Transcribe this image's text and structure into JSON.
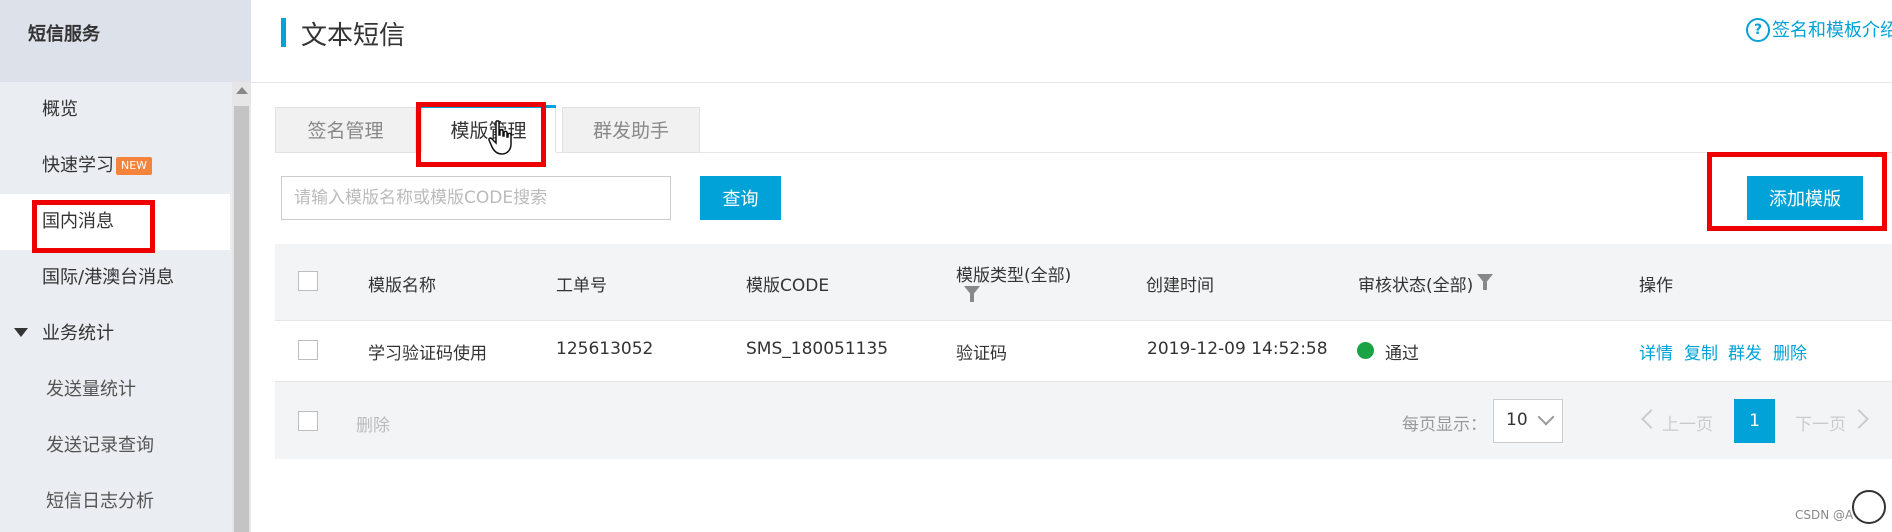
{
  "sidebar": {
    "title": "短信服务",
    "items": [
      {
        "label": "概览"
      },
      {
        "label": "快速学习",
        "badge": "NEW"
      },
      {
        "label": "国内消息"
      },
      {
        "label": "国际/港澳台消息"
      },
      {
        "label": "业务统计"
      },
      {
        "label": "发送量统计"
      },
      {
        "label": "发送记录查询"
      },
      {
        "label": "短信日志分析"
      }
    ]
  },
  "header": {
    "title": "文本短信",
    "help_link": "签名和模板介绍"
  },
  "tabs": [
    {
      "label": "签名管理"
    },
    {
      "label": "模版管理"
    },
    {
      "label": "群发助手"
    }
  ],
  "search": {
    "placeholder": "请输入模版名称或模版CODE搜索",
    "query_button": "查询",
    "add_button": "添加模版"
  },
  "table": {
    "columns": [
      "模版名称",
      "工单号",
      "模版CODE",
      "模版类型(全部)",
      "创建时间",
      "审核状态(全部)",
      "操作"
    ],
    "rows": [
      {
        "name": "学习验证码使用",
        "ticket": "125613052",
        "code": "SMS_180051135",
        "type": "验证码",
        "created": "2019-12-09 14:52:58",
        "status": "通过",
        "actions": [
          "详情",
          "复制",
          "群发",
          "删除"
        ]
      }
    ]
  },
  "footer": {
    "delete_label": "删除",
    "per_page_label": "每页显示：",
    "per_page_value": "10",
    "prev_label": "上一页",
    "current_page": "1",
    "next_label": "下一页"
  },
  "watermark": "CSDN @A",
  "colors": {
    "accent": "#00a2d8",
    "status_ok": "#1aa345",
    "annotation": "#ee0000",
    "badge": "#f5833c"
  }
}
